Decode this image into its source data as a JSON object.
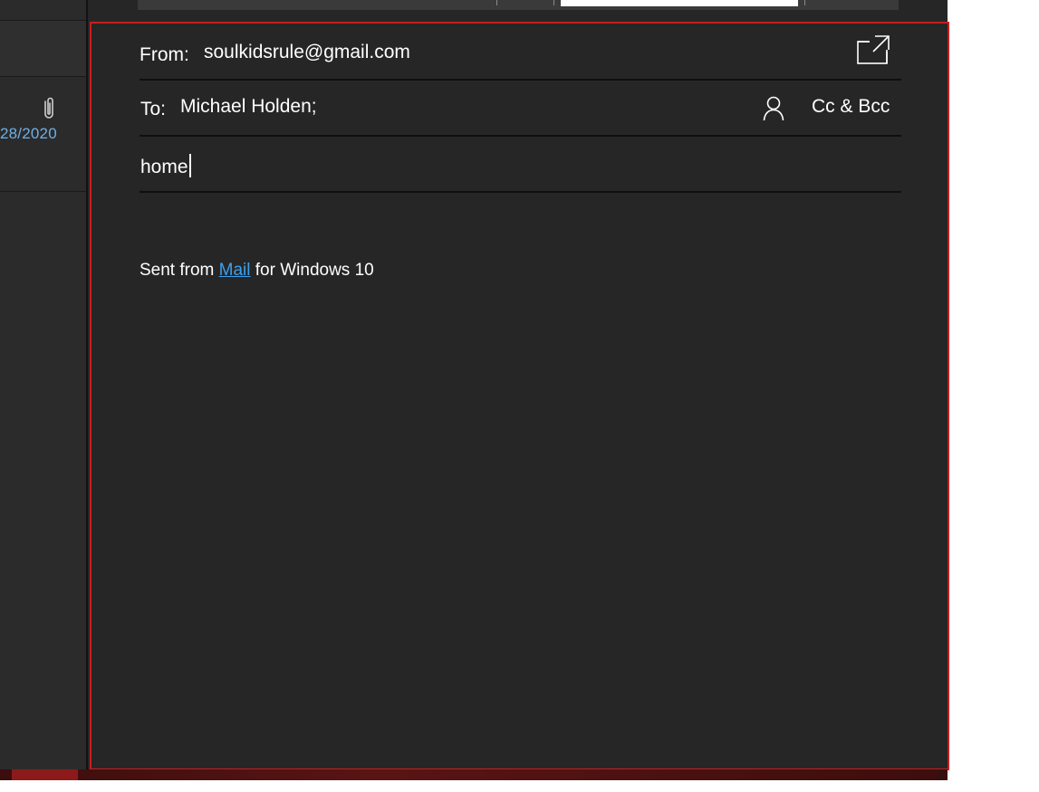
{
  "message_list": {
    "date_fragment": "28/2020",
    "attachment_icon": "paperclip-icon"
  },
  "compose": {
    "from_label": "From:",
    "from_value": "soulkidsrule@gmail.com",
    "to_label": "To:",
    "to_value": "Michael Holden;",
    "cc_bcc_label": "Cc & Bcc",
    "subject_value": "home",
    "body": {
      "signature_prefix": "Sent from ",
      "signature_link": "Mail",
      "signature_suffix": " for Windows 10"
    },
    "icons": {
      "popout": "popout-icon",
      "contact": "person-icon"
    }
  },
  "colors": {
    "background": "#262626",
    "focus_border": "#c81e1e",
    "link": "#3aa0f0",
    "date_text": "#6fb0e6"
  }
}
